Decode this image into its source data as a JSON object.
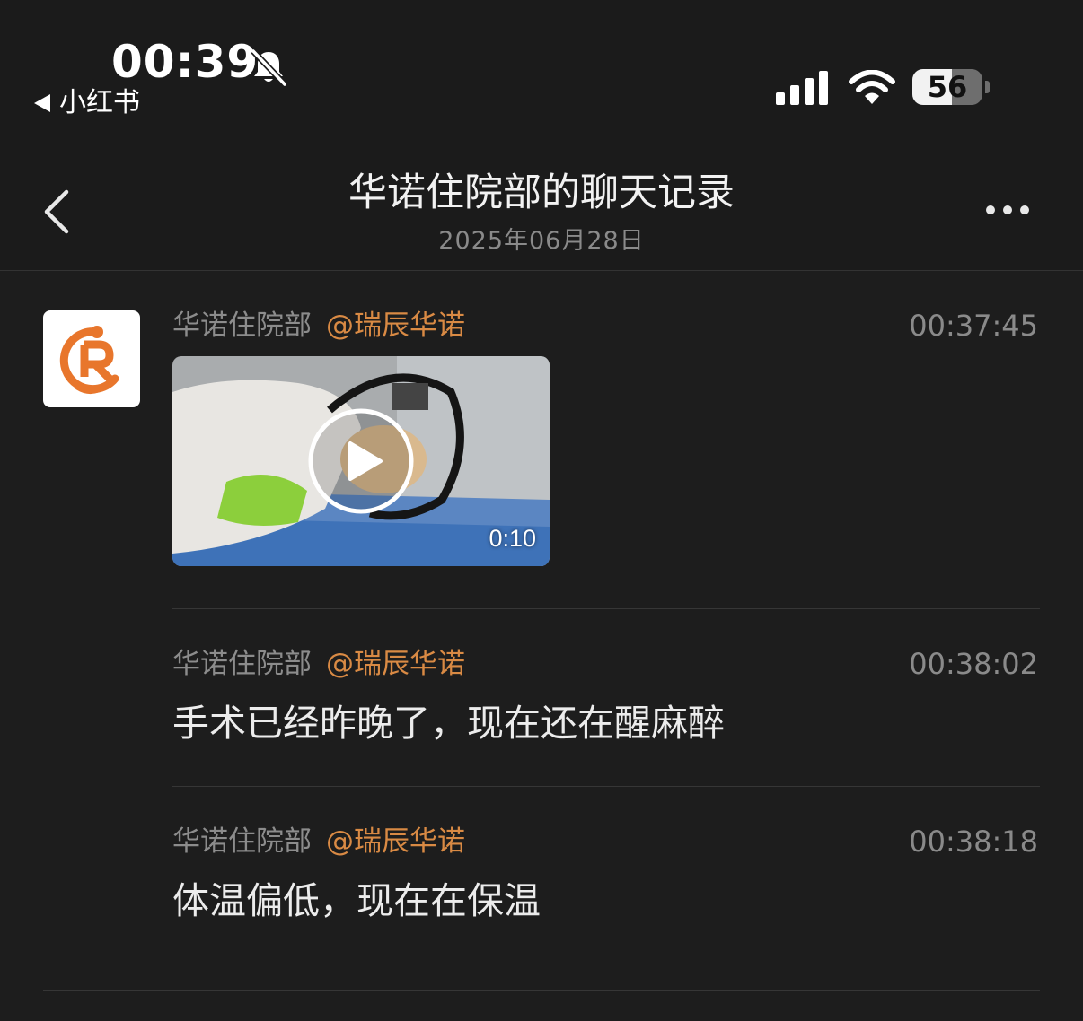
{
  "status_bar": {
    "time": "00:39",
    "back_app": "小红书",
    "battery_level": "56",
    "icons": [
      "bell-muted-icon",
      "signal-icon",
      "wifi-icon",
      "battery-icon"
    ]
  },
  "nav": {
    "title": "华诺住院部的聊天记录",
    "date": "2025年06月28日",
    "icons": [
      "back-chevron-icon",
      "more-icon"
    ]
  },
  "messages": [
    {
      "sender": "华诺住院部",
      "mention": "@瑞辰华诺",
      "time": "00:37:45",
      "type": "video",
      "video_duration": "0:10"
    },
    {
      "sender": "华诺住院部",
      "mention": "@瑞辰华诺",
      "time": "00:38:02",
      "type": "text",
      "text": "手术已经昨晚了，现在还在醒麻醉"
    },
    {
      "sender": "华诺住院部",
      "mention": "@瑞辰华诺",
      "time": "00:38:18",
      "type": "text",
      "text": "体温偏低，现在在保温"
    }
  ],
  "colors": {
    "background": "#1d1d1d",
    "mention": "#d98a44",
    "logo_orange": "#e8762c"
  }
}
